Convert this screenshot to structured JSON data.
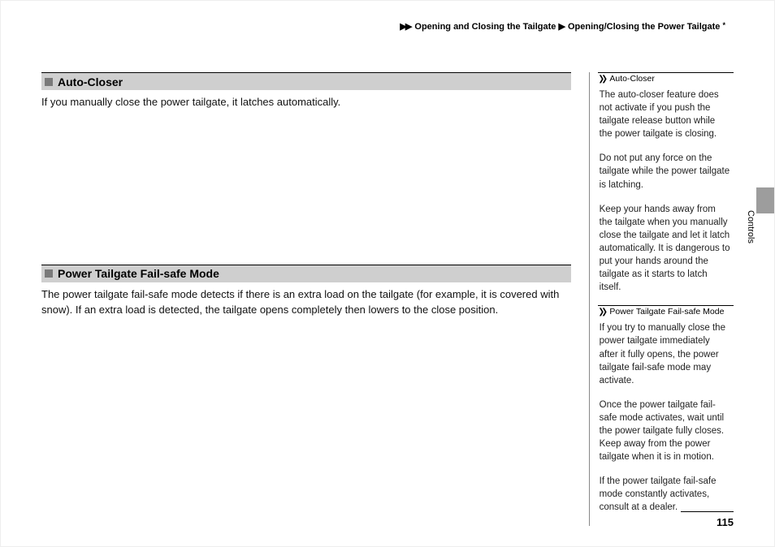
{
  "breadcrumb": {
    "arrows1": "▶▶",
    "seg1": "Opening and Closing the Tailgate",
    "arrow2": "▶",
    "seg2": "Opening/Closing the Power Tailgate",
    "footnote": "*"
  },
  "main": {
    "section1": {
      "title": "Auto-Closer",
      "body": "If you manually close the power tailgate, it latches automatically."
    },
    "section2": {
      "title": "Power Tailgate Fail-safe Mode",
      "body": "The power tailgate fail-safe mode detects if there is an extra load on the tailgate (for example, it is covered with snow). If an extra load is detected, the tailgate opens completely then lowers to the close position."
    }
  },
  "sidebar": {
    "block1": {
      "chev": "❯❯",
      "title": "Auto-Closer",
      "p1": "The auto-closer feature does not activate if you push the tailgate release button while the power tailgate is closing.",
      "p2": "Do not put any force on the tailgate while the power tailgate is latching.",
      "p3": "Keep your hands away from the tailgate when you manually close the tailgate and let it latch automatically. It is dangerous to put your hands around the tailgate as it starts to latch itself."
    },
    "block2": {
      "chev": "❯❯",
      "title": "Power Tailgate Fail-safe Mode",
      "p1": "If you try to manually close the power tailgate immediately after it fully opens, the power tailgate fail-safe mode may activate.",
      "p2": "Once the power tailgate fail-safe mode activates, wait until the power tailgate fully closes. Keep away from the power tailgate when it is in motion.",
      "p3": "If the power tailgate fail-safe mode constantly activates, consult at a dealer."
    }
  },
  "side_label": "Controls",
  "page_number": "115"
}
